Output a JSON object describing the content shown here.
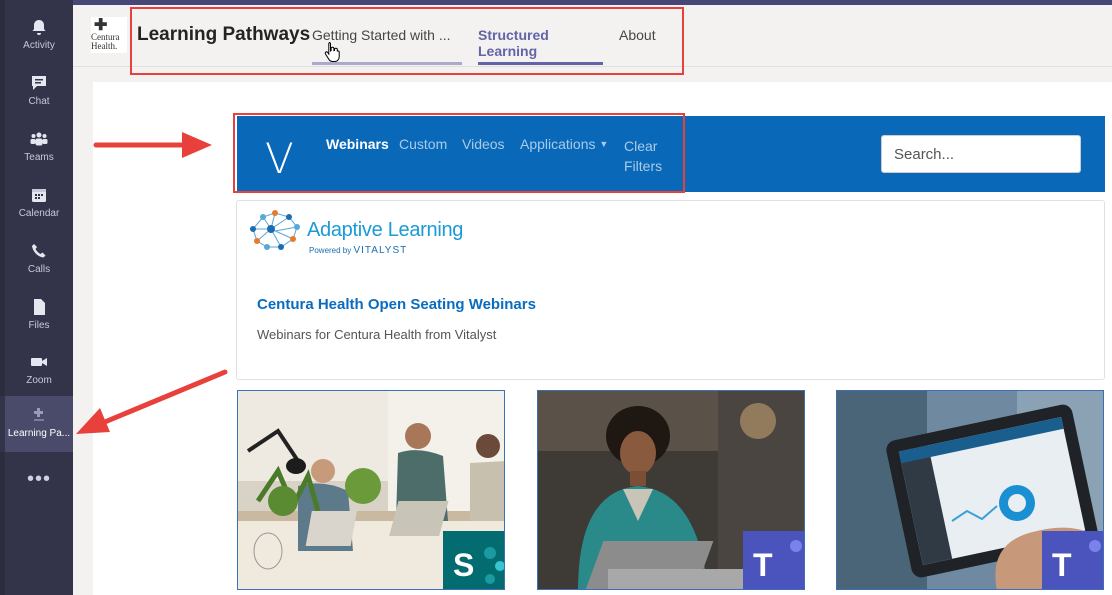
{
  "rail": {
    "items": [
      {
        "label": "Activity",
        "icon": "bell-icon"
      },
      {
        "label": "Chat",
        "icon": "chat-icon"
      },
      {
        "label": "Teams",
        "icon": "teams-icon"
      },
      {
        "label": "Calendar",
        "icon": "calendar-icon"
      },
      {
        "label": "Calls",
        "icon": "phone-icon"
      },
      {
        "label": "Files",
        "icon": "file-icon"
      },
      {
        "label": "Zoom",
        "icon": "video-icon"
      },
      {
        "label": "Learning Pa...",
        "icon": "app-icon"
      }
    ],
    "more": "•••"
  },
  "header": {
    "logo_text_1": "Centura",
    "logo_text_2": "Health.",
    "title": "Learning Pathways",
    "tabs": [
      {
        "label": "Getting Started with ..."
      },
      {
        "label": "Structured Learning"
      },
      {
        "label": "About"
      }
    ]
  },
  "vnav": {
    "logo": "V",
    "links": [
      "Webinars",
      "Custom",
      "Videos",
      "Applications",
      "Clear",
      "Filters"
    ],
    "search_placeholder": "Search..."
  },
  "card": {
    "brand_name": "Adaptive Learning",
    "brand_powered_prefix": "Powered by",
    "brand_powered_name": "VITALYST",
    "title": "Centura Health Open Seating Webinars",
    "description": "Webinars for Centura Health from Vitalyst"
  },
  "colors": {
    "rail": "#33344a",
    "accent": "#6264a7",
    "vitalyst_blue": "#0968b8",
    "annotation_red": "#e8413b"
  }
}
